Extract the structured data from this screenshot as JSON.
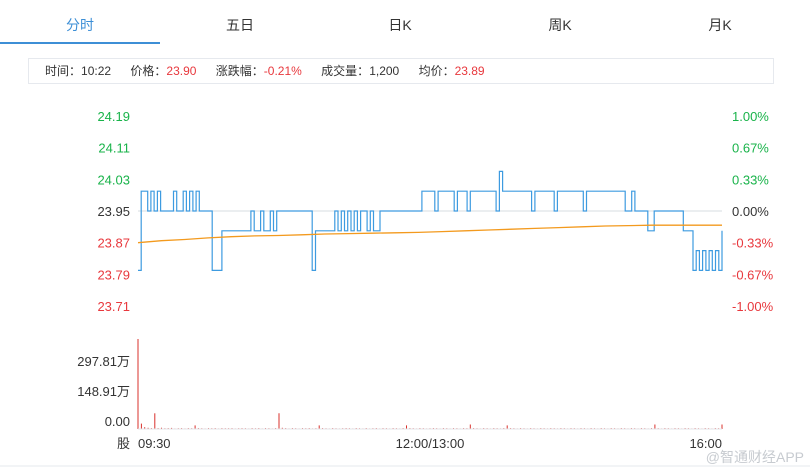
{
  "tabs": [
    "分时",
    "五日",
    "日K",
    "周K",
    "月K"
  ],
  "active_tab": 0,
  "info": {
    "time_label": "时间：",
    "time": "10:22",
    "price_label": "价格：",
    "price": "23.90",
    "change_label": "涨跌幅：",
    "change": "-0.21%",
    "volume_label": "成交量：",
    "volume": "1,200",
    "avg_label": "均价：",
    "avg": "23.89"
  },
  "colors": {
    "up": "#19b34a",
    "down": "#e8383d",
    "price_line": "#3d9be0",
    "avg_line": "#f39a1e",
    "volume": "#d9302b",
    "tab_accent": "#3d8fd6"
  },
  "watermark": "@智通财经APP",
  "chart_data": {
    "type": "line",
    "y_ticks_price": [
      "24.19",
      "24.11",
      "24.03",
      "23.95",
      "23.87",
      "23.79",
      "23.71"
    ],
    "y_ticks_pct": [
      "1.00%",
      "0.67%",
      "0.33%",
      "0.00%",
      "-0.33%",
      "-0.67%",
      "-1.00%"
    ],
    "prev_close": 23.95,
    "ylim": [
      23.71,
      24.19
    ],
    "x_labels": [
      "09:30",
      "12:00/13:00",
      "16:00"
    ],
    "volume_axis_unit_label": "股",
    "volume_ticks": [
      "297.81万",
      "148.91万",
      "0.00"
    ],
    "volume_max": 2978100,
    "series": [
      {
        "role": "price",
        "values": [
          23.8,
          24.0,
          24.0,
          23.95,
          24.0,
          23.95,
          24.0,
          23.95,
          23.95,
          23.95,
          23.95,
          24.0,
          23.95,
          23.95,
          24.0,
          23.95,
          24.0,
          23.95,
          24.0,
          23.95,
          23.95,
          23.95,
          23.95,
          23.8,
          23.8,
          23.8,
          23.9,
          23.9,
          23.9,
          23.9,
          23.9,
          23.9,
          23.9,
          23.9,
          23.9,
          23.95,
          23.9,
          23.9,
          23.95,
          23.9,
          23.9,
          23.95,
          23.9,
          23.95,
          23.95,
          23.95,
          23.95,
          23.95,
          23.95,
          23.95,
          23.95,
          23.95,
          23.95,
          23.95,
          23.8,
          23.9,
          23.9,
          23.9,
          23.9,
          23.9,
          23.9,
          23.95,
          23.9,
          23.95,
          23.9,
          23.95,
          23.9,
          23.95,
          23.9,
          23.95,
          23.95,
          23.9,
          23.95,
          23.9,
          23.9,
          23.95,
          23.95,
          23.95,
          23.95,
          23.95,
          23.95,
          23.95,
          23.95,
          23.95,
          23.95,
          23.95,
          23.95,
          23.95,
          24.0,
          24.0,
          24.0,
          24.0,
          23.95,
          24.0,
          24.0,
          24.0,
          24.0,
          24.0,
          23.95,
          24.0,
          24.0,
          24.0,
          23.95,
          24.0,
          24.0,
          24.0,
          24.0,
          24.0,
          24.0,
          24.0,
          24.0,
          23.95,
          24.05,
          24.0,
          24.0,
          24.0,
          24.0,
          24.0,
          24.0,
          24.0,
          24.0,
          24.0,
          23.95,
          24.0,
          24.0,
          24.0,
          24.0,
          24.0,
          24.0,
          23.95,
          24.0,
          24.0,
          24.0,
          24.0,
          24.0,
          24.0,
          24.0,
          24.0,
          23.95,
          24.0,
          24.0,
          24.0,
          24.0,
          24.0,
          24.0,
          24.0,
          24.0,
          24.0,
          24.0,
          24.0,
          24.0,
          23.95,
          23.95,
          24.0,
          23.95,
          23.95,
          23.95,
          23.95,
          23.9,
          23.9,
          23.95,
          23.95,
          23.95,
          23.95,
          23.95,
          23.95,
          23.95,
          23.95,
          23.95,
          23.9,
          23.9,
          23.9,
          23.8,
          23.85,
          23.8,
          23.85,
          23.8,
          23.85,
          23.8,
          23.85,
          23.8,
          23.9
        ]
      },
      {
        "role": "average",
        "values": [
          23.87,
          23.875,
          23.878,
          23.882,
          23.885,
          23.887,
          23.888,
          23.89,
          23.892,
          23.893,
          23.894,
          23.895,
          23.896,
          23.898,
          23.9,
          23.902,
          23.904,
          23.906,
          23.908,
          23.91,
          23.912,
          23.913,
          23.914,
          23.914,
          23.914,
          23.914
        ]
      }
    ],
    "volume_bars": [
      2978100,
      180000,
      60000,
      40000,
      30000,
      520000,
      30000,
      40000,
      25000,
      30000,
      35000,
      20000,
      25000,
      30000,
      20000,
      30000,
      25000,
      120000,
      30000,
      25000,
      20000,
      30000,
      25000,
      30000,
      20000,
      30000,
      25000,
      25000,
      30000,
      20000,
      25000,
      30000,
      25000,
      20000,
      30000,
      25000,
      30000,
      20000,
      30000,
      25000,
      20000,
      30000,
      520000,
      40000,
      30000,
      20000,
      30000,
      25000,
      20000,
      30000,
      25000,
      30000,
      20000,
      25000,
      120000,
      30000,
      25000,
      20000,
      30000,
      25000,
      20000,
      25000,
      30000,
      25000,
      20000,
      30000,
      25000,
      20000,
      30000,
      20000,
      25000,
      30000,
      20000,
      30000,
      25000,
      20000,
      30000,
      25000,
      20000,
      30000,
      120000,
      30000,
      25000,
      20000,
      30000,
      25000,
      20000,
      25000,
      30000,
      25000,
      20000,
      30000,
      25000,
      20000,
      30000,
      25000,
      20000,
      30000,
      25000,
      150000,
      30000,
      25000,
      20000,
      30000,
      25000,
      20000,
      30000,
      25000,
      20000,
      30000,
      120000,
      30000,
      25000,
      20000,
      30000,
      25000,
      20000,
      30000,
      25000,
      20000,
      30000,
      25000,
      20000,
      30000,
      25000,
      20000,
      30000,
      25000,
      20000,
      30000,
      25000,
      20000,
      30000,
      25000,
      20000,
      30000,
      25000,
      20000,
      30000,
      25000,
      20000,
      30000,
      25000,
      20000,
      30000,
      25000,
      20000,
      30000,
      25000,
      20000,
      30000,
      25000,
      20000,
      30000,
      150000,
      25000,
      20000,
      30000,
      25000,
      20000,
      30000,
      25000,
      20000,
      30000,
      25000,
      20000,
      30000,
      25000,
      20000,
      30000,
      25000,
      20000,
      30000,
      25000,
      150000
    ]
  }
}
